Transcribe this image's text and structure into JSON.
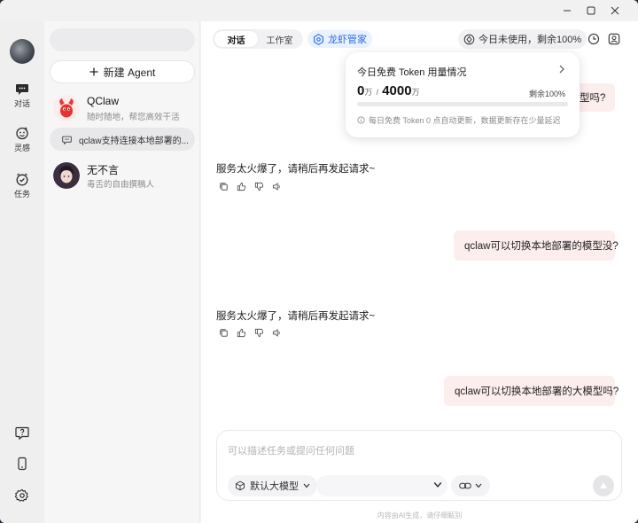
{
  "window": {
    "controls": [
      "minimize",
      "maximize",
      "close"
    ]
  },
  "rail": {
    "items": [
      {
        "label": "对话",
        "icon": "chat-icon"
      },
      {
        "label": "灵感",
        "icon": "inspiration-icon"
      },
      {
        "label": "任务",
        "icon": "task-clock-icon"
      }
    ],
    "bottom_icons": [
      "help-icon",
      "phone-icon",
      "settings-icon"
    ]
  },
  "sidebar": {
    "new_agent_label": "新建 Agent",
    "agents": [
      {
        "name": "QClaw",
        "subtitle": "随时随地，帮您高效干活"
      },
      {
        "name": "无不言",
        "subtitle": "毒舌的自由撰稿人"
      }
    ],
    "sub_chat": "qclaw支持连接本地部署的..."
  },
  "header": {
    "tabs": [
      {
        "label": "对话",
        "active": true
      },
      {
        "label": "工作室",
        "active": false
      }
    ],
    "manager_badge": "龙虾管家",
    "usage_pill": "今日未使用，剩余100%"
  },
  "popup": {
    "title": "今日免费 Token 用量情况",
    "used": "0",
    "used_unit": "万",
    "separator": "/",
    "total": "4000",
    "total_unit": "万",
    "remaining": "剩余100%",
    "used_fraction": 0,
    "note": "每日免费 Token 0 点自动更新，数据更新存在少量延迟",
    "colors": {
      "accent": "#2e6ae6"
    }
  },
  "messages": {
    "user_1_partial": "型吗?",
    "bot_1": "服务太火爆了，请稍后再发起请求~",
    "user_2": "qclaw可以切换本地部署的模型没?",
    "bot_2": "服务太火爆了，请稍后再发起请求~",
    "user_3": "qclaw可以切换本地部署的大模型吗?"
  },
  "composer": {
    "placeholder": "可以描述任务或提问任何问题",
    "model_label": "默认大模型",
    "footnote": "内容由AI生成，请仔细甄别"
  },
  "colors": {
    "user_bubble": "#fdeeee",
    "brand_blue": "#2e6ae6"
  }
}
